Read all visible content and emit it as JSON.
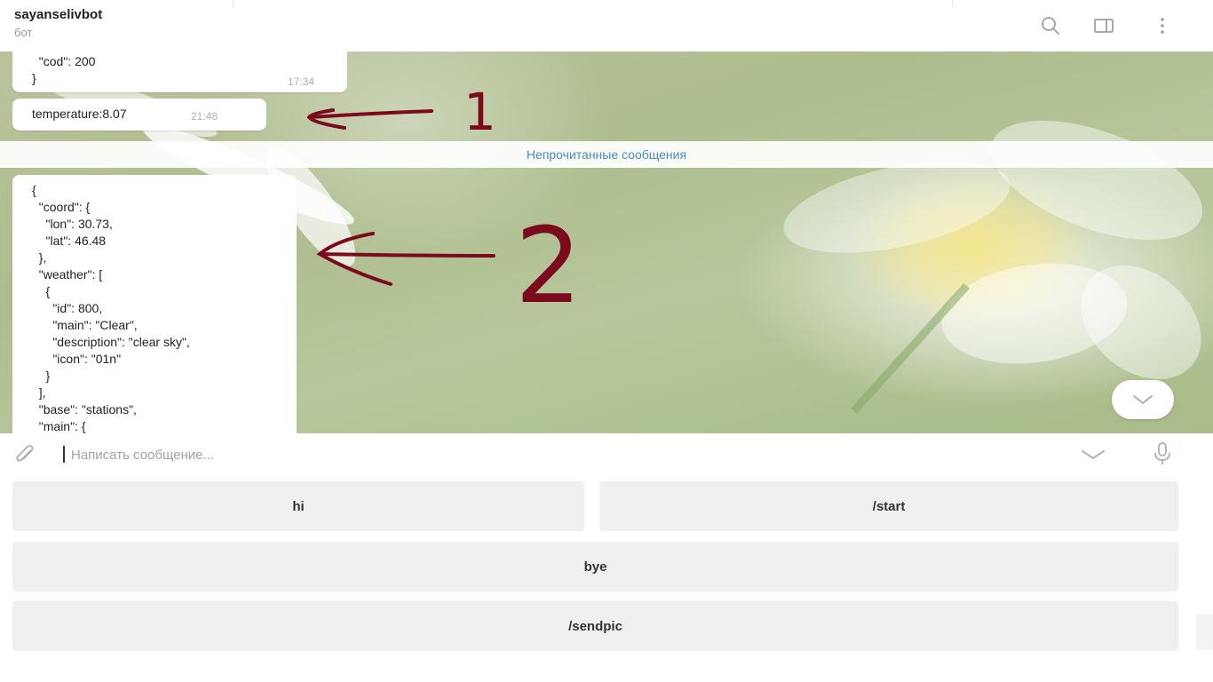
{
  "header": {
    "title": "sayanselivbot",
    "subtitle": "бот",
    "icons": [
      "search-icon",
      "side-panel-icon",
      "more-vertical-icon"
    ]
  },
  "messages": [
    {
      "text": "  \"cod\": 200\n}",
      "time": "17:34"
    },
    {
      "text": "temperature:8.07",
      "time": "21:48"
    },
    {
      "text": "{\n  \"coord\": {\n    \"lon\": 30.73,\n    \"lat\": 46.48\n  },\n  \"weather\": [\n    {\n      \"id\": 800,\n      \"main\": \"Clear\",\n      \"description\": \"clear sky\",\n      \"icon\": \"01n\"\n    }\n  ],\n  \"base\": \"stations\",\n  \"main\": {"
    }
  ],
  "unread_label": "Непрочитанные сообщения",
  "annotations": {
    "label_1": "1",
    "label_2": "2",
    "color": "#7a0a1c"
  },
  "compose": {
    "placeholder": "Написать сообщение...",
    "value": "",
    "icons": [
      "paperclip-icon",
      "chevron-down-icon",
      "microphone-icon"
    ]
  },
  "keyboard": {
    "rows": [
      [
        "hi",
        "/start"
      ],
      [
        "bye"
      ],
      [
        "/sendpic"
      ]
    ]
  },
  "colors": {
    "accent": "#4d8ac0",
    "button_bg": "#f0f0f0",
    "bubble_bg": "#ffffff"
  }
}
